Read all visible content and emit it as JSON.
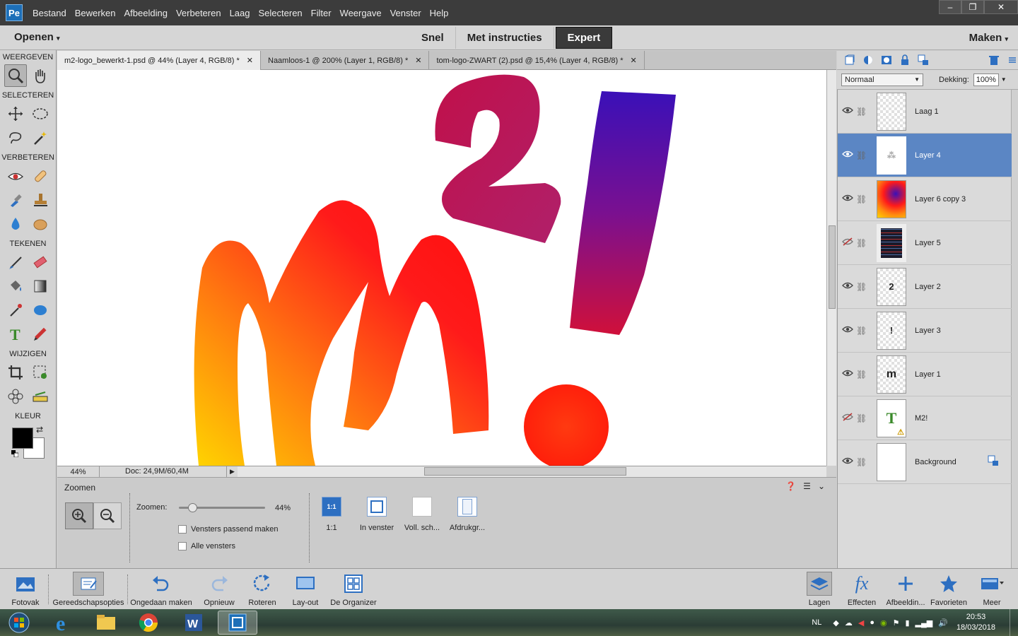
{
  "app": {
    "icon_label": "Pe"
  },
  "menu": [
    "Bestand",
    "Bewerken",
    "Afbeelding",
    "Verbeteren",
    "Laag",
    "Selecteren",
    "Filter",
    "Weergave",
    "Venster",
    "Help"
  ],
  "window_controls": {
    "minimize": "–",
    "restore": "❐",
    "close": "✕"
  },
  "modebar": {
    "open_label": "Openen",
    "tabs": [
      "Snel",
      "Met instructies",
      "Expert"
    ],
    "active_tab": "Expert",
    "make_label": "Maken"
  },
  "toolbox": {
    "sections": [
      "WEERGEVEN",
      "SELECTEREN",
      "VERBETEREN",
      "TEKENEN",
      "WIJZIGEN",
      "KLEUR"
    ],
    "foreground_color": "#000000",
    "background_color": "#ffffff"
  },
  "doc_tabs": [
    {
      "title": "m2-logo_bewerkt-1.psd @ 44% (Layer 4, RGB/8) *",
      "active": true
    },
    {
      "title": "Naamloos-1 @ 200% (Layer 1, RGB/8) *",
      "active": false
    },
    {
      "title": "tom-logo-ZWART (2).psd @ 15,4% (Layer 4, RGB/8) *",
      "active": false
    }
  ],
  "statusbar": {
    "zoom": "44%",
    "doc_size": "Doc: 24,9M/60,4M"
  },
  "tool_options": {
    "title": "Zoomen",
    "zoom_label": "Zoomen:",
    "zoom_value": "44%",
    "zoom_fraction": 0.44,
    "checkboxes": [
      "Vensters passend maken",
      "Alle vensters"
    ],
    "view_buttons": [
      {
        "icon_text": "1:1",
        "label": "1:1"
      },
      {
        "icon_text": "",
        "label": "In venster"
      },
      {
        "icon_text": "",
        "label": "Voll. sch..."
      },
      {
        "icon_text": "",
        "label": "Afdrukgr..."
      }
    ]
  },
  "layers_panel": {
    "blend_mode": "Normaal",
    "opacity_label": "Dekking:",
    "opacity_value": "100%",
    "layers": [
      {
        "name": "Laag 1",
        "visible": true,
        "selected": false,
        "thumb": "empty"
      },
      {
        "name": "Layer 4",
        "visible": true,
        "selected": true,
        "thumb": "sketch"
      },
      {
        "name": "Layer 6 copy 3",
        "visible": true,
        "selected": false,
        "thumb": "gradient"
      },
      {
        "name": "Layer 5",
        "visible": false,
        "selected": false,
        "thumb": "dark"
      },
      {
        "name": "Layer 2",
        "visible": true,
        "selected": false,
        "thumb": "2"
      },
      {
        "name": "Layer 3",
        "visible": true,
        "selected": false,
        "thumb": "!"
      },
      {
        "name": "Layer 1",
        "visible": true,
        "selected": false,
        "thumb": "m"
      },
      {
        "name": "M2!",
        "visible": false,
        "selected": false,
        "thumb": "T"
      },
      {
        "name": "Background",
        "visible": true,
        "selected": false,
        "thumb": "white"
      }
    ]
  },
  "bottombar": {
    "left": [
      "Fotovak",
      "Gereedschapsopties",
      "Ongedaan maken",
      "Opnieuw",
      "Roteren",
      "Lay-out",
      "De Organizer"
    ],
    "right": [
      "Lagen",
      "Effecten",
      "Afbeeldin...",
      "Favorieten",
      "Meer"
    ]
  },
  "taskbar": {
    "language": "NL",
    "time": "20:53",
    "date": "18/03/2018"
  }
}
